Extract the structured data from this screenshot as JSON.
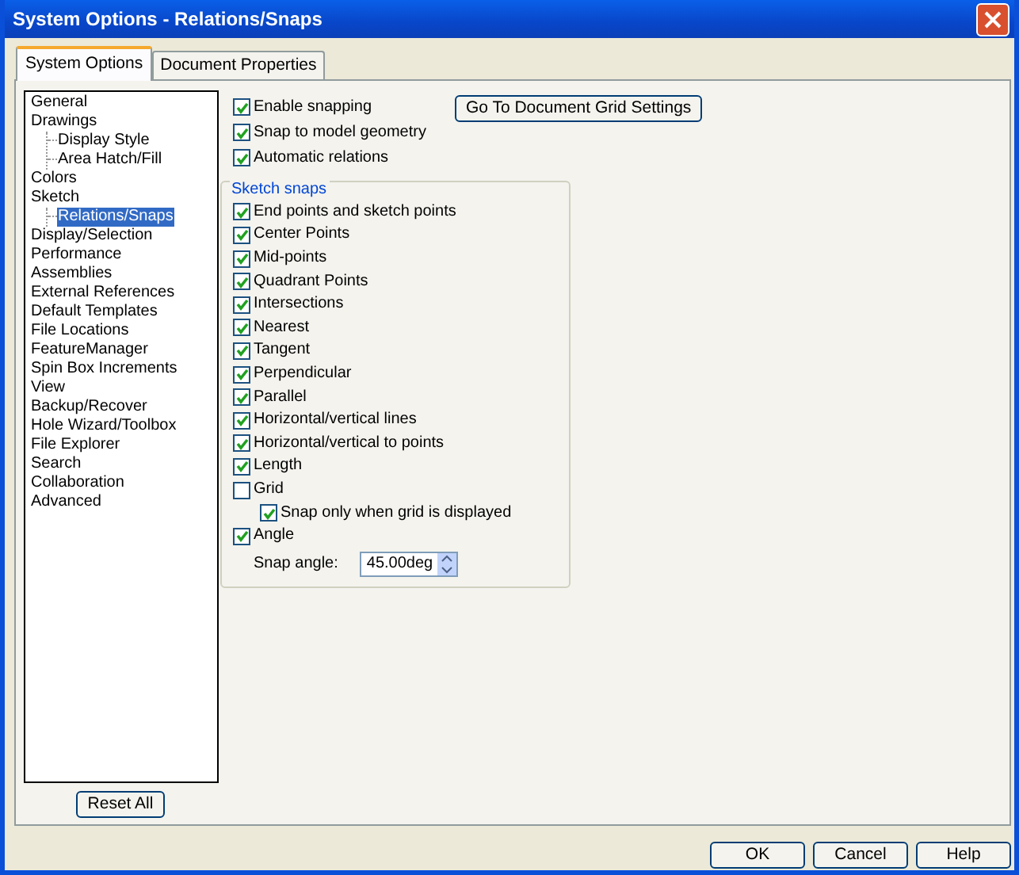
{
  "window": {
    "title": "System Options - Relations/Snaps"
  },
  "tabs": [
    {
      "label": "System Options",
      "selected": true
    },
    {
      "label": "Document Properties",
      "selected": false
    }
  ],
  "tree": [
    {
      "label": "General",
      "selected": false
    },
    {
      "label": "Drawings",
      "selected": false,
      "children": [
        {
          "label": "Display Style",
          "selected": false
        },
        {
          "label": "Area Hatch/Fill",
          "selected": false
        }
      ]
    },
    {
      "label": "Colors",
      "selected": false
    },
    {
      "label": "Sketch",
      "selected": false,
      "children": [
        {
          "label": "Relations/Snaps",
          "selected": true
        }
      ]
    },
    {
      "label": "Display/Selection",
      "selected": false
    },
    {
      "label": "Performance",
      "selected": false
    },
    {
      "label": "Assemblies",
      "selected": false
    },
    {
      "label": "External References",
      "selected": false
    },
    {
      "label": "Default Templates",
      "selected": false
    },
    {
      "label": "File Locations",
      "selected": false
    },
    {
      "label": "FeatureManager",
      "selected": false
    },
    {
      "label": "Spin Box Increments",
      "selected": false
    },
    {
      "label": "View",
      "selected": false
    },
    {
      "label": "Backup/Recover",
      "selected": false
    },
    {
      "label": "Hole Wizard/Toolbox",
      "selected": false
    },
    {
      "label": "File Explorer",
      "selected": false
    },
    {
      "label": "Search",
      "selected": false
    },
    {
      "label": "Collaboration",
      "selected": false
    },
    {
      "label": "Advanced",
      "selected": false
    }
  ],
  "reset_button": "Reset All",
  "options": [
    {
      "label": "Enable snapping",
      "checked": true
    },
    {
      "label": "Snap to model geometry",
      "checked": true
    },
    {
      "label": "Automatic relations",
      "checked": true
    }
  ],
  "grid_button": "Go To Document Grid Settings",
  "sketch_snaps": {
    "title": "Sketch snaps",
    "items": [
      {
        "label": "End points and sketch points",
        "checked": true
      },
      {
        "label": "Center Points",
        "checked": true
      },
      {
        "label": "Mid-points",
        "checked": true
      },
      {
        "label": "Quadrant Points",
        "checked": true
      },
      {
        "label": "Intersections",
        "checked": true
      },
      {
        "label": "Nearest",
        "checked": true
      },
      {
        "label": "Tangent",
        "checked": true
      },
      {
        "label": "Perpendicular",
        "checked": true
      },
      {
        "label": "Parallel",
        "checked": true
      },
      {
        "label": "Horizontal/vertical lines",
        "checked": true
      },
      {
        "label": "Horizontal/vertical to points",
        "checked": true
      },
      {
        "label": "Length",
        "checked": true
      },
      {
        "label": "Grid",
        "checked": false,
        "children": [
          {
            "label": "Snap only when grid is displayed",
            "checked": true
          }
        ]
      },
      {
        "label": "Angle",
        "checked": true
      }
    ],
    "snap_angle": {
      "label": "Snap angle:",
      "value": "45.00deg"
    }
  },
  "buttons": [
    "OK",
    "Cancel",
    "Help"
  ]
}
